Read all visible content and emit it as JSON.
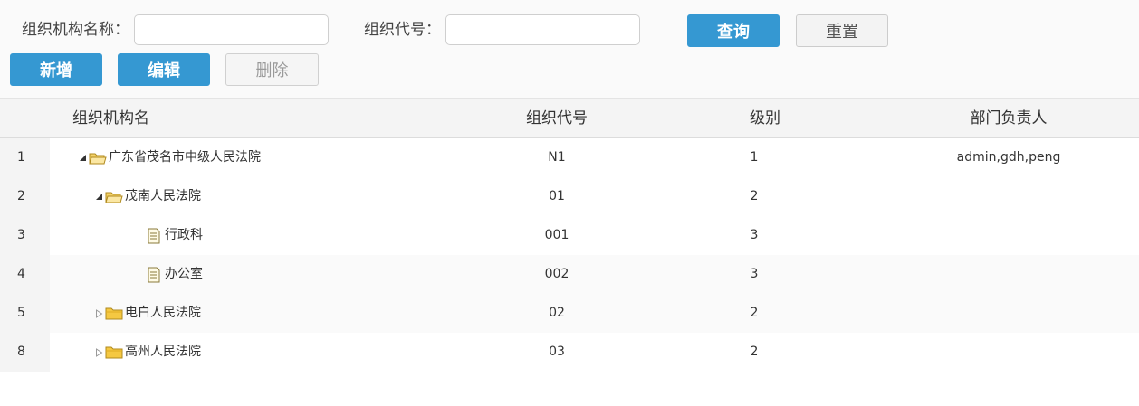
{
  "search": {
    "name_label": "组织机构名称：",
    "name_value": "",
    "code_label": "组织代号：",
    "code_value": "",
    "query_button": "查询",
    "reset_button": "重置"
  },
  "actions": {
    "add_button": "新增",
    "edit_button": "编辑",
    "delete_button": "删除"
  },
  "table": {
    "columns": [
      "组织机构名",
      "组织代号",
      "级别",
      "部门负责人"
    ],
    "rows": [
      {
        "num": "1",
        "name": "广东省茂名市中级人民法院",
        "code": "N1",
        "level": "1",
        "manager": "admin,gdh,peng",
        "depth": 0,
        "node": "expanded",
        "icon": "folder-open-icon"
      },
      {
        "num": "2",
        "name": "茂南人民法院",
        "code": "01",
        "level": "2",
        "manager": "",
        "depth": 1,
        "node": "expanded",
        "icon": "folder-open-icon"
      },
      {
        "num": "3",
        "name": "行政科",
        "code": "001",
        "level": "3",
        "manager": "",
        "depth": 2,
        "node": "leaf",
        "icon": "document-icon"
      },
      {
        "num": "4",
        "name": "办公室",
        "code": "002",
        "level": "3",
        "manager": "",
        "depth": 2,
        "node": "leaf",
        "icon": "document-icon"
      },
      {
        "num": "5",
        "name": "电白人民法院",
        "code": "02",
        "level": "2",
        "manager": "",
        "depth": 1,
        "node": "collapsed",
        "icon": "folder-icon"
      },
      {
        "num": "8",
        "name": "高州人民法院",
        "code": "03",
        "level": "2",
        "manager": "",
        "depth": 1,
        "node": "collapsed",
        "icon": "folder-icon"
      }
    ]
  },
  "colors": {
    "primary": "#3598d2",
    "header_bg": "#f4f4f4",
    "toolbar_bg": "#fafafa",
    "folder": "#f5c842"
  }
}
